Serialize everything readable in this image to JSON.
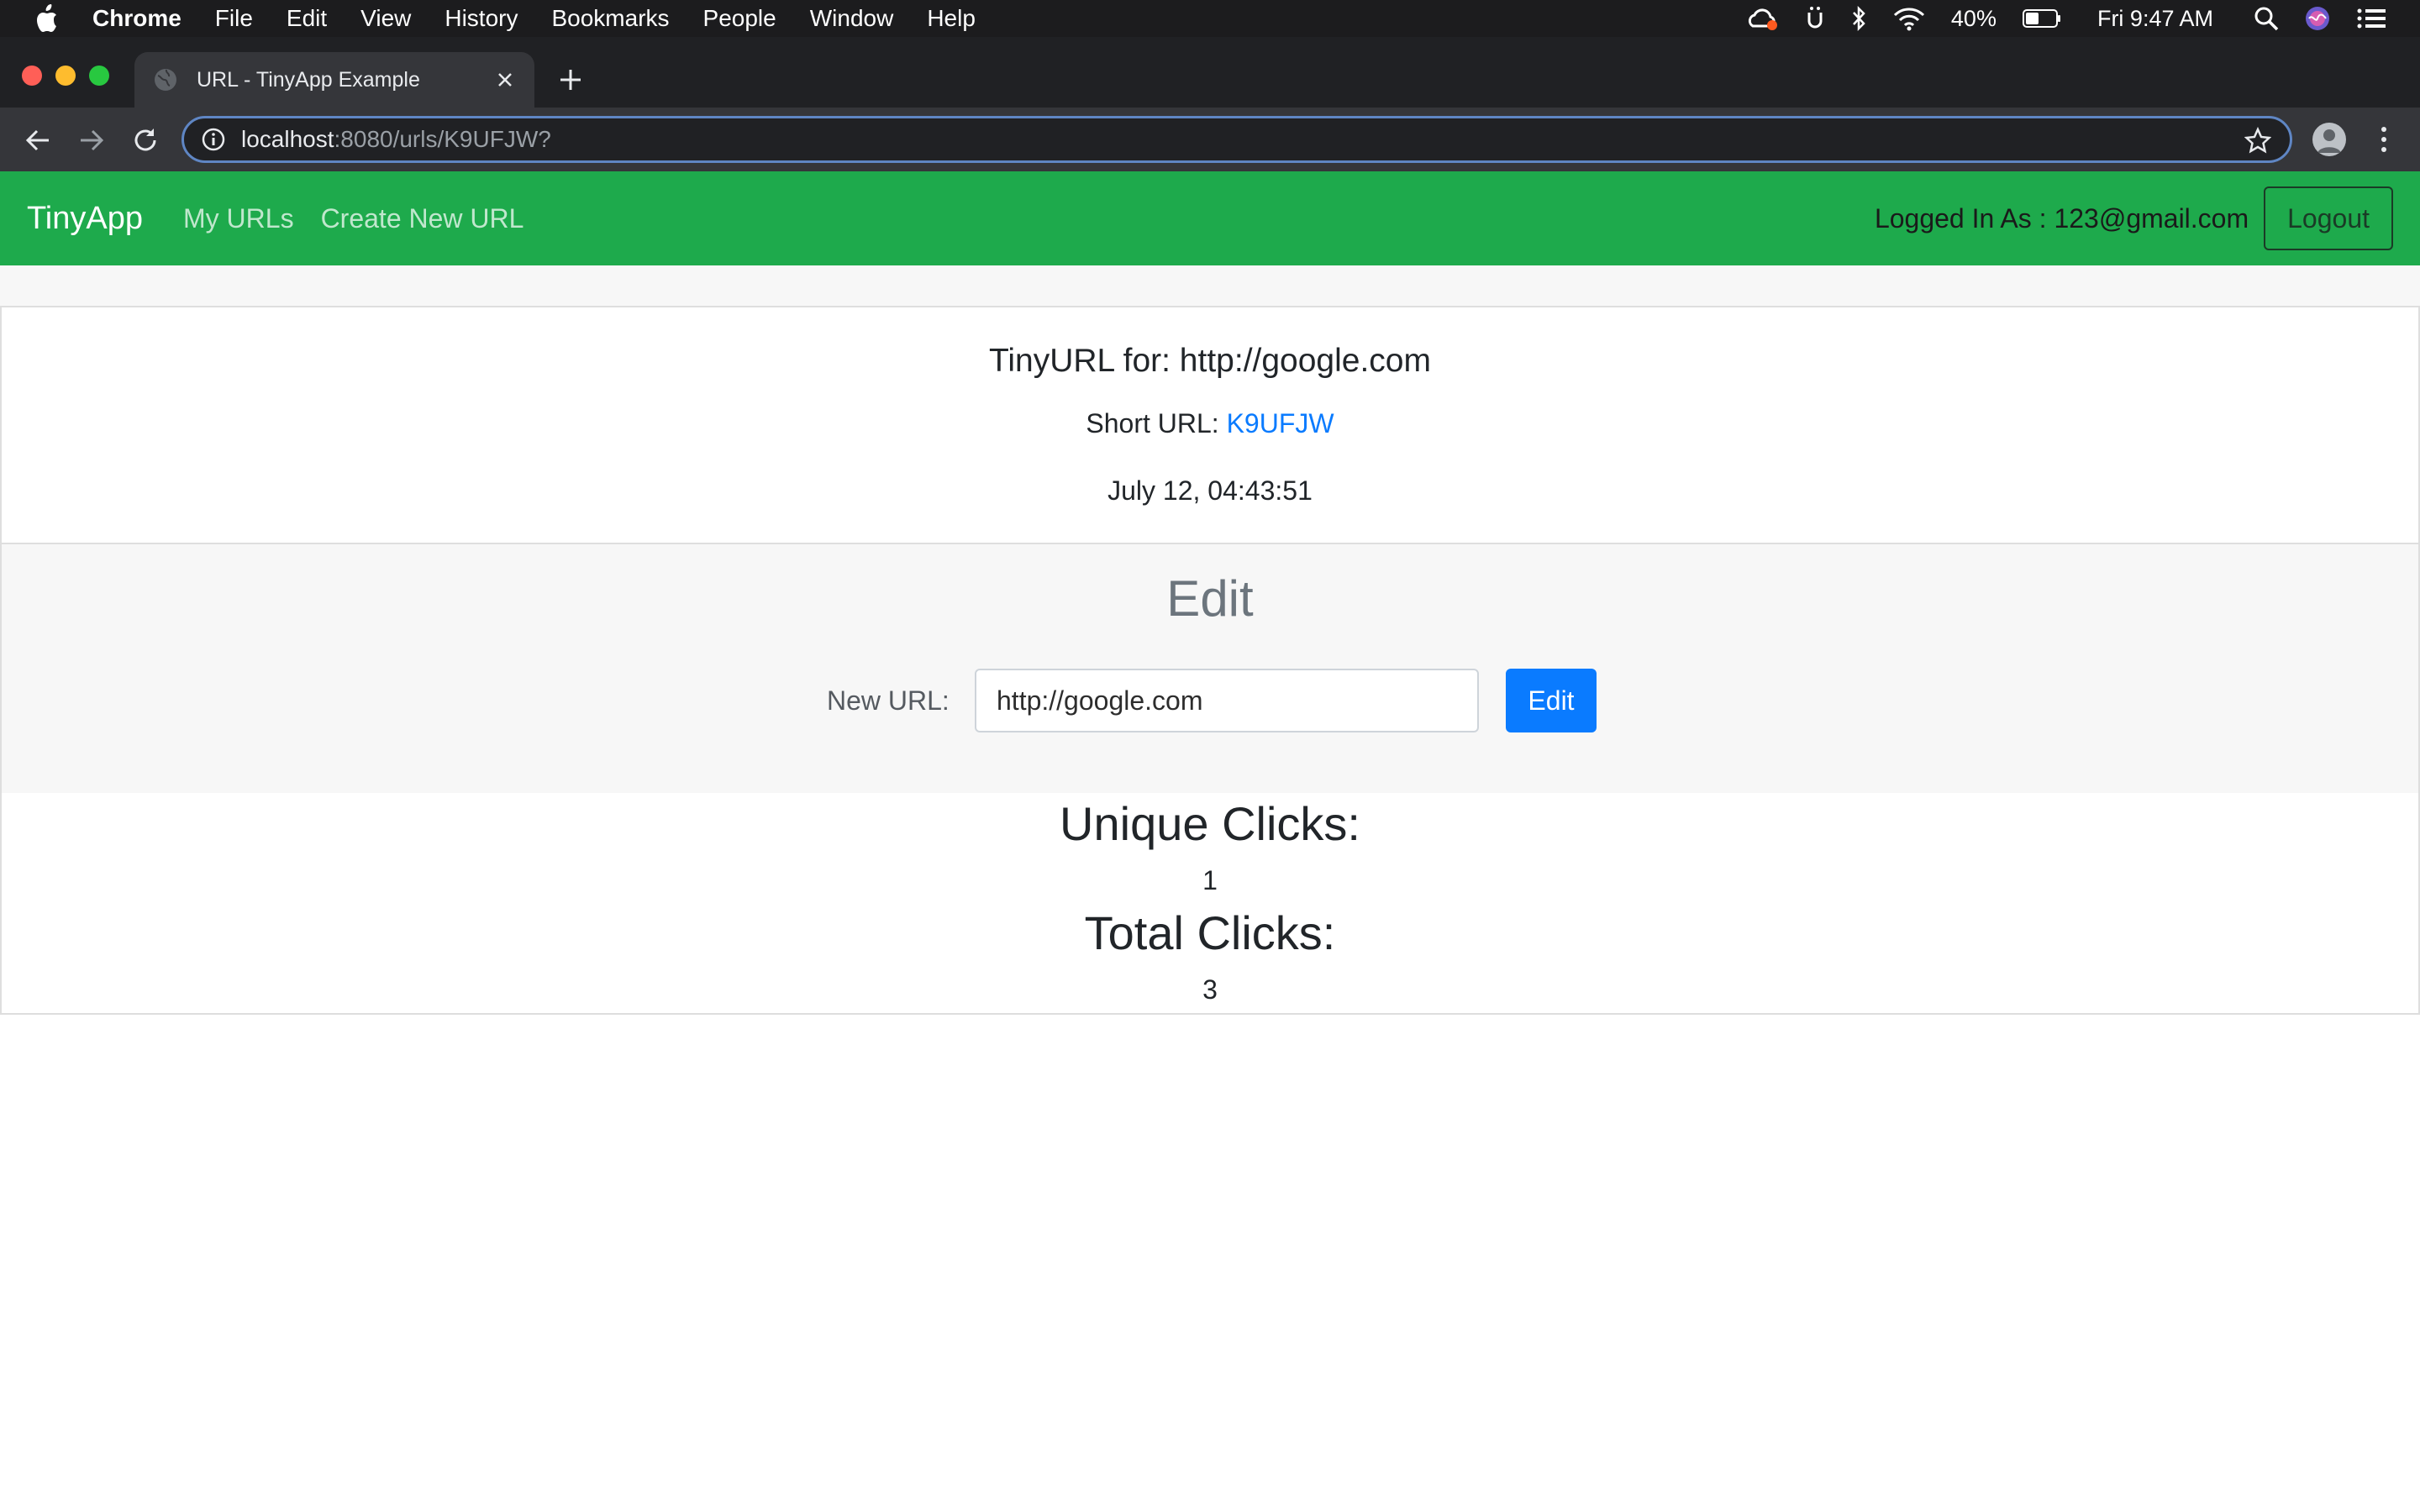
{
  "menubar": {
    "app": "Chrome",
    "items": [
      "File",
      "Edit",
      "View",
      "History",
      "Bookmarks",
      "People",
      "Window",
      "Help"
    ],
    "battery": "40%",
    "clock": "Fri 9:47 AM"
  },
  "browser": {
    "tab_title": "URL - TinyApp Example",
    "url_host": "localhost",
    "url_rest": ":8080/urls/K9UFJW?"
  },
  "navbar": {
    "brand": "TinyApp",
    "links": [
      "My URLs",
      "Create New URL"
    ],
    "logged_in": "Logged In As : 123@gmail.com",
    "logout": "Logout",
    "bg_color": "#1eaa4c"
  },
  "card": {
    "title": "TinyURL for: http://google.com",
    "short_label": "Short URL: ",
    "short_code": "K9UFJW",
    "date": "July 12, 04:43:51"
  },
  "edit": {
    "heading": "Edit",
    "label": "New URL:",
    "value": "http://google.com",
    "button": "Edit"
  },
  "stats": {
    "unique_label": "Unique Clicks:",
    "unique_value": "1",
    "total_label": "Total Clicks:",
    "total_value": "3"
  }
}
